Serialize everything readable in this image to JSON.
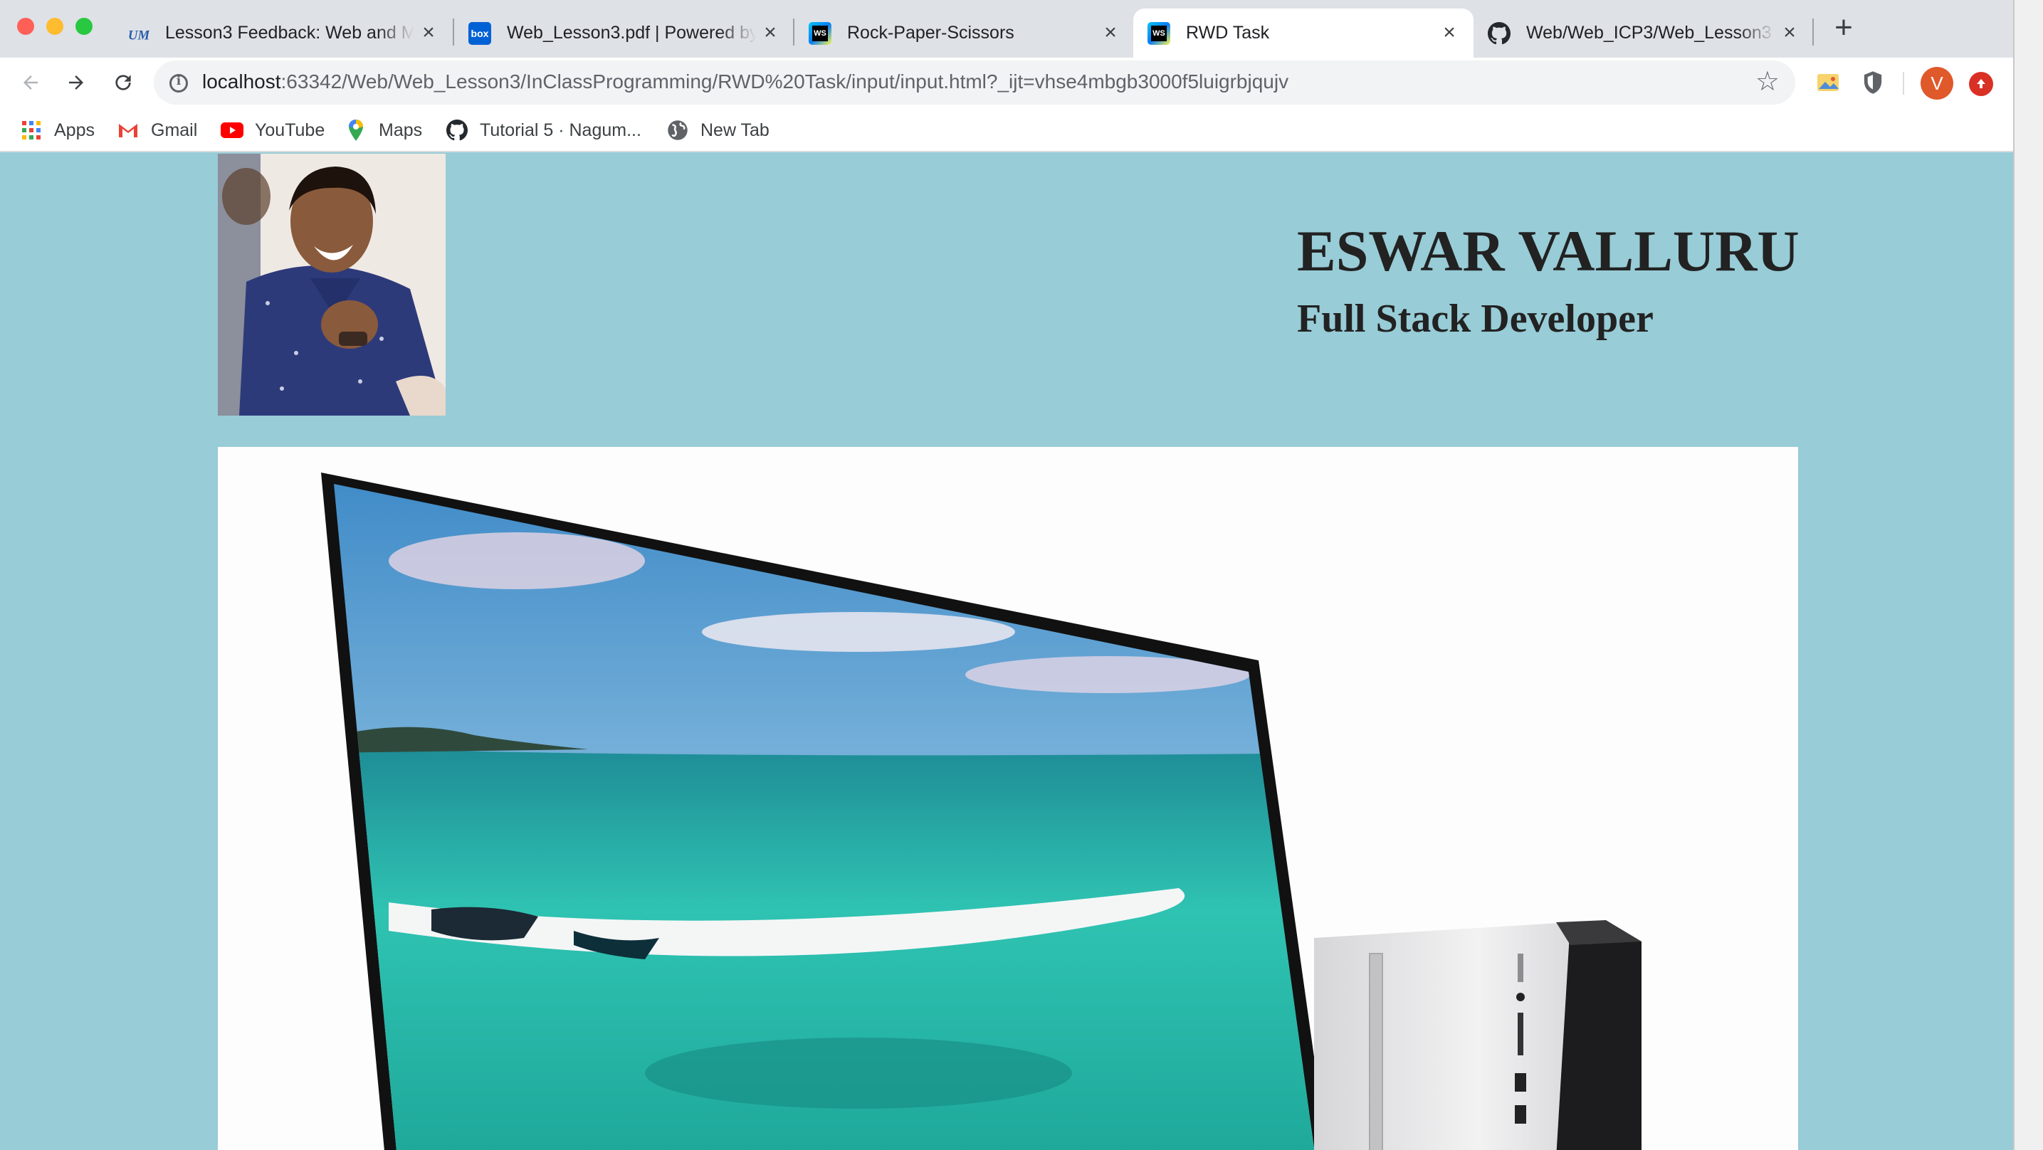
{
  "browser": {
    "tabs": [
      {
        "title": "Lesson3 Feedback: Web and Mobile Programming",
        "favicon": "umkc-logo-icon",
        "active": false
      },
      {
        "title": "Web_Lesson3.pdf | Powered by Box",
        "favicon": "box-icon",
        "active": false
      },
      {
        "title": "Rock-Paper-Scissors",
        "favicon": "webstorm-icon",
        "active": false
      },
      {
        "title": "RWD Task",
        "favicon": "webstorm-icon",
        "active": true
      },
      {
        "title": "Web/Web_ICP3/Web_Lesson3",
        "favicon": "github-icon",
        "active": false
      }
    ],
    "url_host": "localhost",
    "url_rest": ":63342/Web/Web_Lesson3/InClassProgramming/RWD%20Task/input/input.html?_ijt=vhse4mbgb3000f5luigrbjqujv",
    "profile_initial": "V",
    "bookmarks": [
      {
        "label": "Apps",
        "icon": "apps-grid-icon"
      },
      {
        "label": "Gmail",
        "icon": "gmail-icon"
      },
      {
        "label": "YouTube",
        "icon": "youtube-icon"
      },
      {
        "label": "Maps",
        "icon": "maps-icon"
      },
      {
        "label": "Tutorial 5 · Nagum...",
        "icon": "github-icon"
      },
      {
        "label": "New Tab",
        "icon": "globe-icon"
      }
    ]
  },
  "page": {
    "name": "ESWAR VALLURU",
    "role": "Full Stack Developer"
  },
  "colors": {
    "page_background": "#98ccd7",
    "tabstrip": "#dee1e6"
  }
}
